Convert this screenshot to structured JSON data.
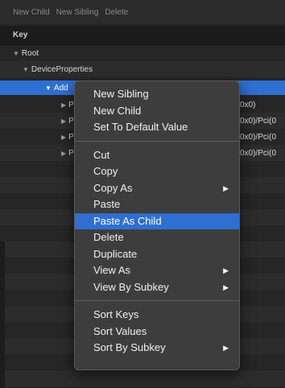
{
  "toolbar": {
    "new_child": "New Child",
    "new_sibling": "New Sibling",
    "delete": "Delete"
  },
  "header": {
    "key_label": "Key"
  },
  "tree": {
    "root": "Root",
    "device_properties": "DeviceProperties",
    "selected_partial": "Add",
    "child_partials": [
      "P",
      "P",
      "P",
      "P"
    ],
    "values": [
      "0x0)",
      "0x0)/Pci(0",
      "0x0)/Pci(0",
      "0x0)/Pci(0"
    ]
  },
  "menu": {
    "group1": [
      "New Sibling",
      "New Child",
      "Set To Default Value"
    ],
    "group2": [
      {
        "label": "Cut",
        "submenu": false
      },
      {
        "label": "Copy",
        "submenu": false
      },
      {
        "label": "Copy As",
        "submenu": true
      },
      {
        "label": "Paste",
        "submenu": false
      },
      {
        "label": "Paste As Child",
        "submenu": false,
        "highlighted": true
      },
      {
        "label": "Delete",
        "submenu": false
      },
      {
        "label": "Duplicate",
        "submenu": false
      },
      {
        "label": "View As",
        "submenu": true
      },
      {
        "label": "View By Subkey",
        "submenu": true
      }
    ],
    "group3": [
      {
        "label": "Sort Keys",
        "submenu": false
      },
      {
        "label": "Sort Values",
        "submenu": false
      },
      {
        "label": "Sort By Subkey",
        "submenu": true
      }
    ]
  },
  "icons": {
    "disclosure_open": "▼",
    "disclosure_closed": "▶",
    "submenu_arrow": "▶"
  },
  "colors": {
    "selection": "#2f6fd1",
    "background": "#262626",
    "menu_bg": "#3d3d3d"
  }
}
